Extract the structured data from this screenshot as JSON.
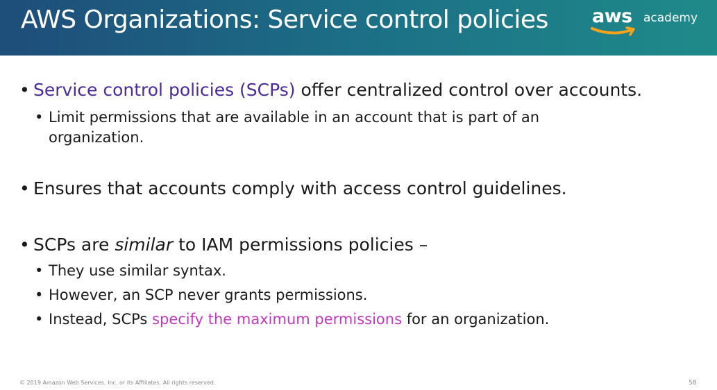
{
  "header": {
    "title": "AWS Organizations: Service control policies",
    "logo": {
      "brand": "aws",
      "product": "academy"
    }
  },
  "bullets": {
    "b1": {
      "highlight": "Service control policies (SCPs)",
      "rest": " offer centralized control over accounts.",
      "sub": {
        "line1": "Limit permissions that are available in an account that is part of an",
        "line2": "organization."
      }
    },
    "b2": {
      "text": "Ensures that accounts comply with access control guidelines."
    },
    "b3": {
      "pre": "SCPs are ",
      "em": "similar",
      "post": " to IAM permissions policies –",
      "sub1": "They use similar syntax.",
      "sub2": "However, an SCP never grants permissions.",
      "sub3_pre": "Instead, SCPs ",
      "sub3_highlight": "specify the maximum permissions",
      "sub3_post": " for an organization."
    }
  },
  "footer": {
    "copyright": "© 2019 Amazon Web Services, Inc. or its Affiliates. All rights reserved.",
    "page": "58"
  },
  "colors": {
    "header_start": "#1e4d7a",
    "header_end": "#1f8a8a",
    "purple": "#4b2b9a",
    "magenta": "#c238c2",
    "logo_smile": "#f7a21b"
  }
}
